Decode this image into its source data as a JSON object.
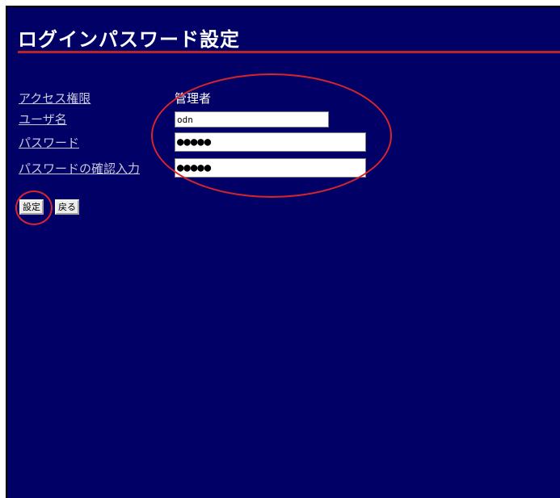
{
  "page": {
    "title": "ログインパスワード設定"
  },
  "form": {
    "access_label": "アクセス権限",
    "access_value": "管理者",
    "username_label": "ユーザ名",
    "username_value": "odn",
    "password_label": "パスワード",
    "password_value": "●●●●●",
    "confirm_label": "パスワードの確認入力",
    "confirm_value": "●●●●●"
  },
  "buttons": {
    "set_label": "設定",
    "back_label": "戻る"
  },
  "colors": {
    "background": "#000066",
    "title_rule": "#c0222a",
    "annotation_circle": "#d8242c"
  }
}
